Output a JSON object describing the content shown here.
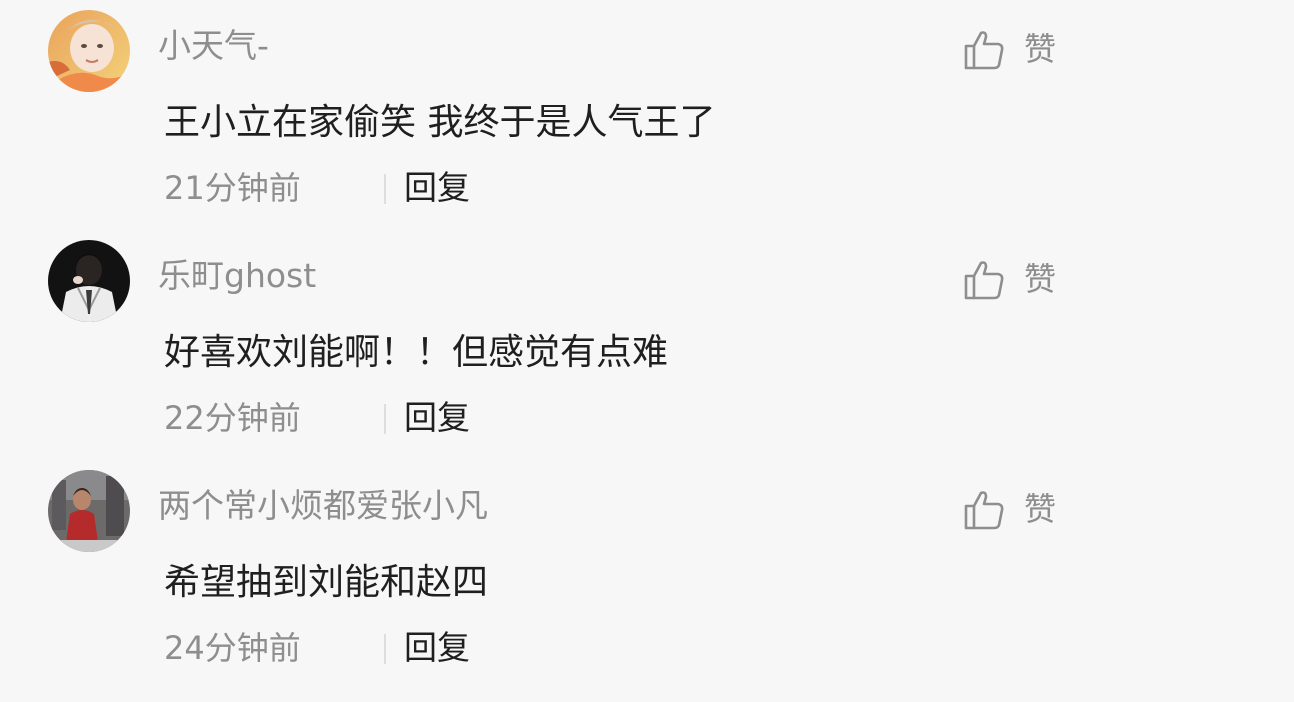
{
  "comments": [
    {
      "username": "小天气-",
      "avatar_icon": "user-avatar-photo",
      "content": "王小立在家偷笑 我终于是人气王了",
      "time": "21分钟前",
      "reply_label": "回复",
      "like_label": "赞",
      "like_icon": "thumbs-up-icon"
    },
    {
      "username": "乐町ghost",
      "avatar_icon": "user-avatar-photo",
      "content": "好喜欢刘能啊！！但感觉有点难",
      "time": "22分钟前",
      "reply_label": "回复",
      "like_label": "赞",
      "like_icon": "thumbs-up-icon"
    },
    {
      "username": "两个常小烦都爱张小凡",
      "avatar_icon": "user-avatar-photo",
      "content": "希望抽到刘能和赵四",
      "time": "24分钟前",
      "reply_label": "回复",
      "like_label": "赞",
      "like_icon": "thumbs-up-icon"
    }
  ],
  "colors": {
    "background": "#f7f7f7",
    "secondary_text": "#8e8e8e",
    "primary_text": "#1f1f1f",
    "divider": "#dedede"
  }
}
